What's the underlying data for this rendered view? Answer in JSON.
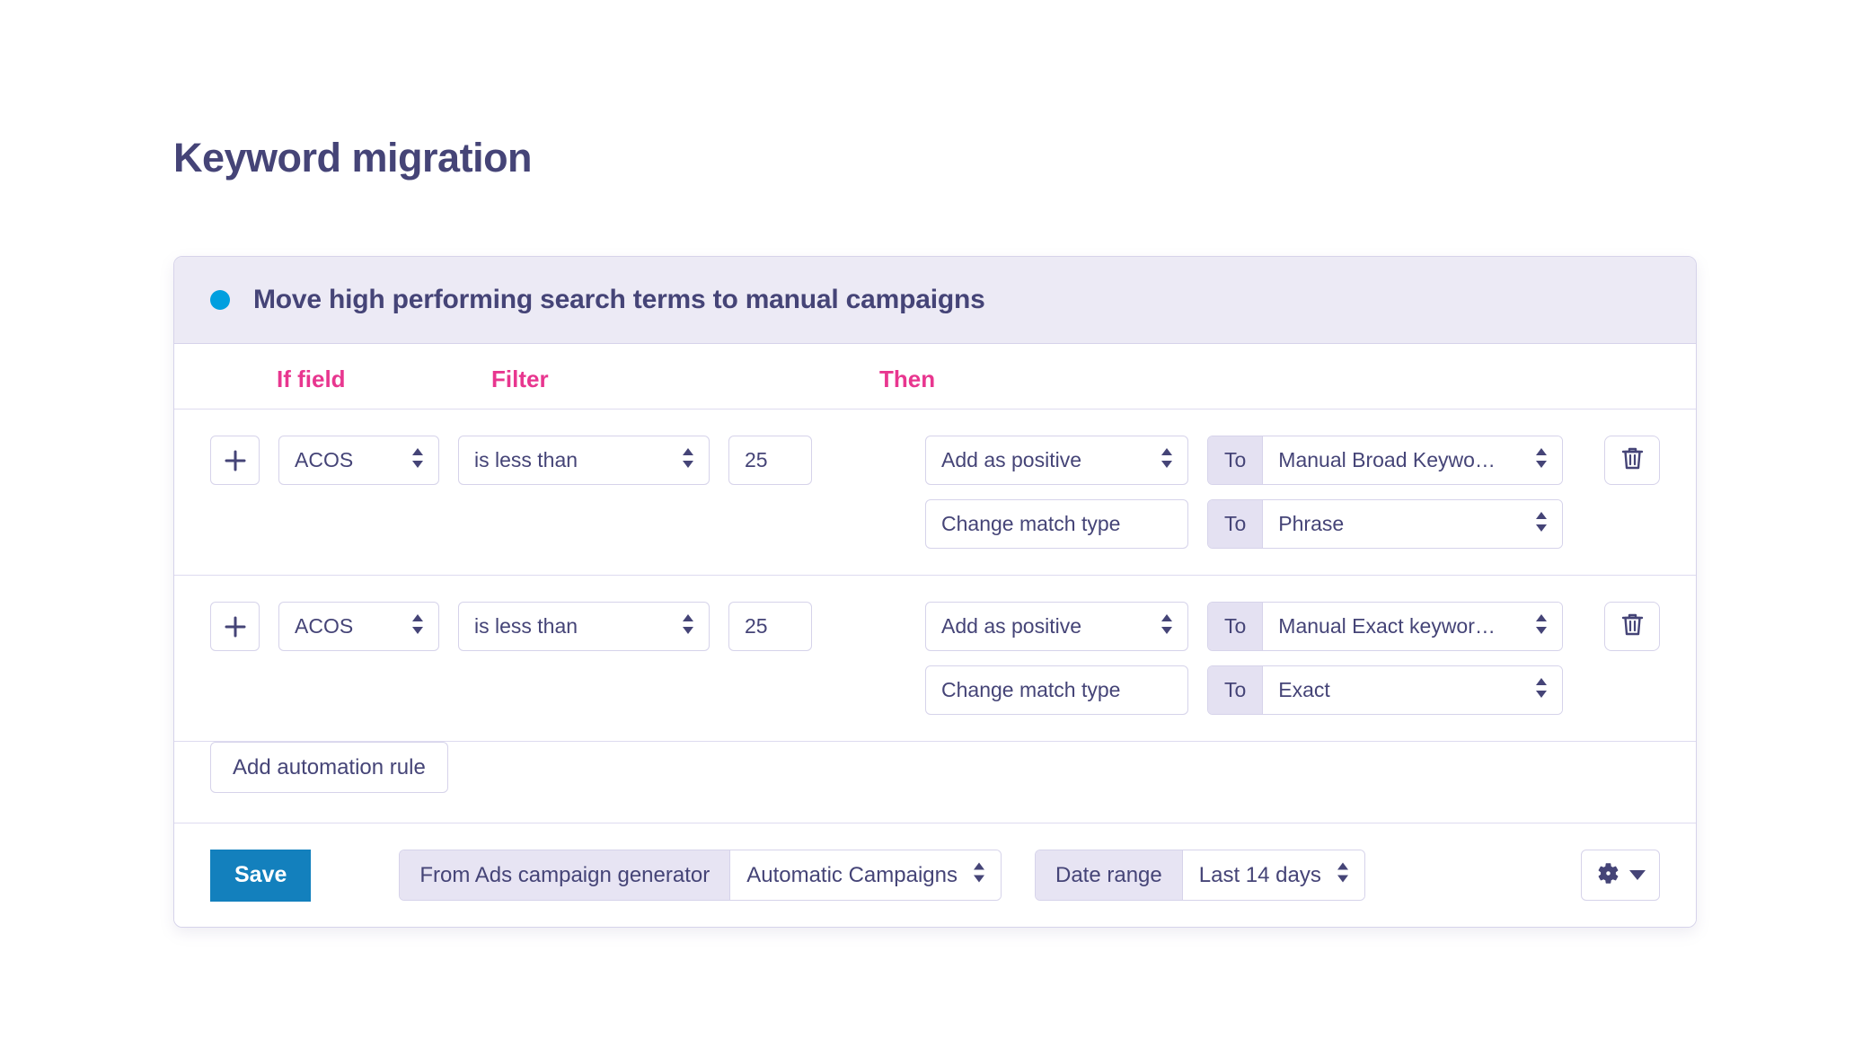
{
  "page": {
    "title": "Keyword migration"
  },
  "card": {
    "header": {
      "title": "Move high performing search terms to manual campaigns",
      "status_dot_color": "#009fdf"
    },
    "columns": {
      "if_field": "If field",
      "filter": "Filter",
      "then": "Then"
    },
    "rules": [
      {
        "add_label": "+",
        "field": "ACOS",
        "operator": "is less than",
        "value": "25",
        "actions": [
          {
            "action": "Add as positive",
            "to_label": "To",
            "target": "Manual Broad Keywo…",
            "has_arrow": true
          },
          {
            "action": "Change match type",
            "to_label": "To",
            "target": "Phrase",
            "has_arrow": false
          }
        ],
        "delete_icon": "trash-icon"
      },
      {
        "add_label": "+",
        "field": "ACOS",
        "operator": "is less than",
        "value": "25",
        "actions": [
          {
            "action": "Add as positive",
            "to_label": "To",
            "target": "Manual Exact keywor…",
            "has_arrow": true
          },
          {
            "action": "Change match type",
            "to_label": "To",
            "target": "Exact",
            "has_arrow": false
          }
        ],
        "delete_icon": "trash-icon"
      }
    ],
    "add_rule_label": "Add automation rule",
    "footer": {
      "save_label": "Save",
      "source_label": "From Ads campaign generator",
      "source_value": "Automatic Campaigns",
      "date_label": "Date range",
      "date_value": "Last 14 days",
      "settings_icon": "gear-icon"
    }
  },
  "colors": {
    "accent_pink": "#e8368f",
    "title_purple": "#454477",
    "save_blue": "#1380bd",
    "status_blue": "#009fdf",
    "header_band": "#eceaf5",
    "border_lavender": "#d6d3ea"
  }
}
